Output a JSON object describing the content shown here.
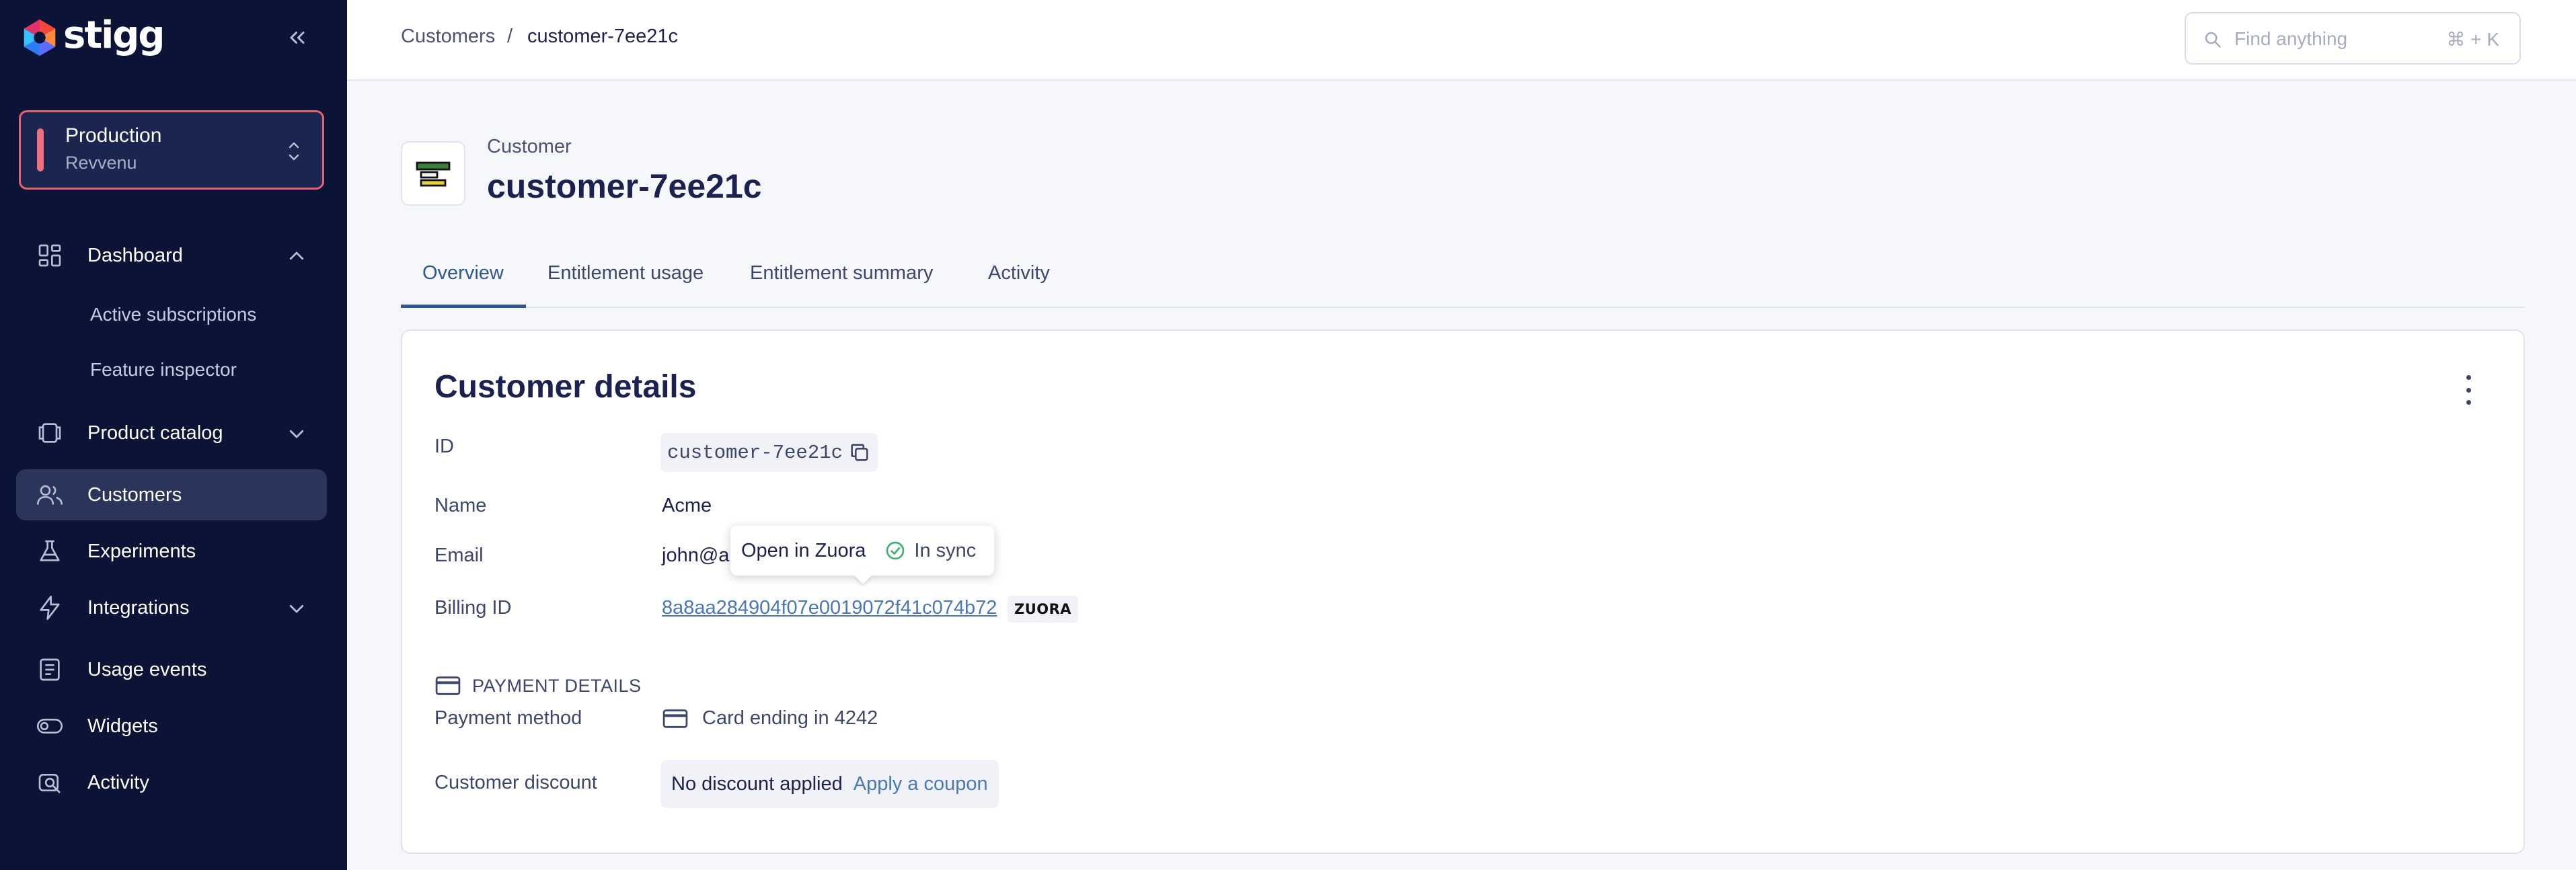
{
  "app": {
    "logo_text": "stigg"
  },
  "environment": {
    "name": "Production",
    "project": "Revvenu"
  },
  "sidebar": {
    "items": [
      {
        "label": "Dashboard",
        "icon": "dashboard-icon",
        "expanded": true
      },
      {
        "label": "Active subscriptions"
      },
      {
        "label": "Feature inspector"
      },
      {
        "label": "Product catalog",
        "icon": "product-catalog-icon",
        "expanded": false
      },
      {
        "label": "Customers",
        "icon": "customers-icon",
        "active": true
      },
      {
        "label": "Experiments",
        "icon": "flask-icon"
      },
      {
        "label": "Integrations",
        "icon": "lightning-icon",
        "expanded": false
      },
      {
        "label": "Usage events",
        "icon": "document-list-icon"
      },
      {
        "label": "Widgets",
        "icon": "toggle-icon"
      },
      {
        "label": "Activity",
        "icon": "activity-icon"
      }
    ]
  },
  "header": {
    "breadcrumb": {
      "parent": "Customers",
      "separator": "/",
      "current": "customer-7ee21c"
    },
    "search": {
      "placeholder": "Find anything",
      "shortcut": "⌘ + K"
    }
  },
  "customer": {
    "kicker": "Customer",
    "title": "customer-7ee21c"
  },
  "tabs": [
    {
      "label": "Overview",
      "active": true
    },
    {
      "label": "Entitlement usage"
    },
    {
      "label": "Entitlement summary"
    },
    {
      "label": "Activity"
    }
  ],
  "details": {
    "title": "Customer details",
    "id_label": "ID",
    "id_value": "customer-7ee21c",
    "name_label": "Name",
    "name_value": "Acme",
    "email_label": "Email",
    "email_value": "john@a",
    "billing_label": "Billing ID",
    "billing_value": "8a8aa284904f07e0019072f41c074b72",
    "billing_provider": "ZUORA",
    "tooltip": {
      "open_label": "Open in Zuora",
      "sync_label": "In sync"
    },
    "payment_section": "PAYMENT DETAILS",
    "payment_method_label": "Payment method",
    "payment_method_value": "Card ending in 4242",
    "discount_label": "Customer discount",
    "discount_value": "No discount applied",
    "discount_action": "Apply a coupon"
  },
  "colors": {
    "sidebar_bg": "#0b1437",
    "active_nav": "#2b355c",
    "env_border": "#e5626f",
    "accent": "#2f5690",
    "link": "#4a78b5",
    "sync_green": "#3bb273"
  }
}
